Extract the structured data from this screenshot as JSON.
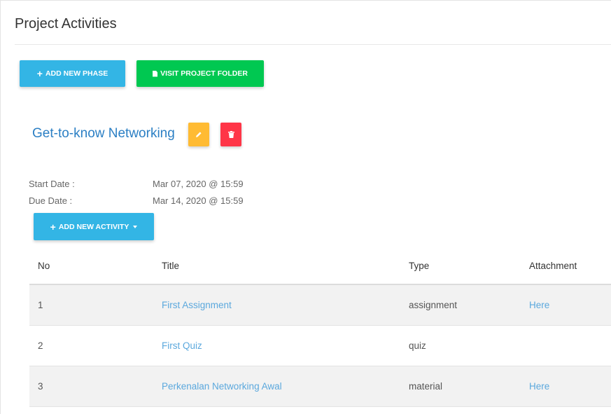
{
  "page": {
    "title": "Project Activities"
  },
  "toolbar": {
    "add_phase_label": "ADD NEW PHASE",
    "visit_folder_label": "VISIT PROJECT FOLDER"
  },
  "phase": {
    "title": "Get-to-know Networking",
    "start_label": "Start Date :",
    "start_value": "Mar 07, 2020 @ 15:59",
    "due_label": "Due Date :",
    "due_value": "Mar 14, 2020 @ 15:59",
    "add_activity_label": "ADD NEW ACTIVITY"
  },
  "table": {
    "headers": [
      "No",
      "Title",
      "Type",
      "Attachment"
    ],
    "rows": [
      {
        "no": "1",
        "title": "First Assignment",
        "type": "assignment",
        "attachment": "Here"
      },
      {
        "no": "2",
        "title": "First Quiz",
        "type": "quiz",
        "attachment": ""
      },
      {
        "no": "3",
        "title": "Perkenalan Networking Awal",
        "type": "material",
        "attachment": "Here"
      }
    ]
  },
  "colors": {
    "info": "#33b5e5",
    "success": "#00c851",
    "warning": "#ffbb33",
    "danger": "#ff3547",
    "link": "#5ba8dd",
    "phase_title": "#2b7fc4"
  },
  "icons": [
    "plus-icon",
    "file-icon",
    "pencil-icon",
    "trash-icon",
    "caret-down-icon"
  ]
}
